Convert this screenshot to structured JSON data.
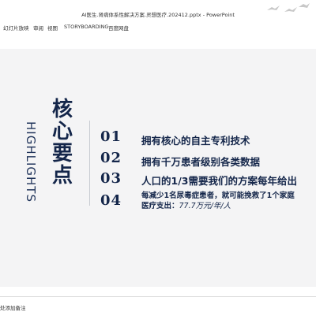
{
  "window": {
    "title": "AI医生.肾病体系性解决方案.灵想医疗.202412.pptx - PowerPoint"
  },
  "menu": [
    "幻灯片放映",
    "审阅",
    "视图",
    "STORYBOARDING",
    "百度网盘"
  ],
  "slide": {
    "heading_cn": [
      "核",
      "心",
      "要",
      "点"
    ],
    "heading_en": "HIGHLIGHTS",
    "items": [
      {
        "num": "01",
        "text": "拥有核心的自主专利技术"
      },
      {
        "num": "02",
        "text": "拥有千万患者级别各类数据"
      },
      {
        "num": "03",
        "text": "人口的1/3需要我们的方案每年给出"
      },
      {
        "num": "04",
        "line1": "每减少1名尿毒症患者，就可能挽救了1个家庭",
        "line2_prefix": "医疗支出：",
        "line2_value": "77.7万元/年/人"
      }
    ]
  },
  "notes": {
    "placeholder": "处添加备注"
  }
}
